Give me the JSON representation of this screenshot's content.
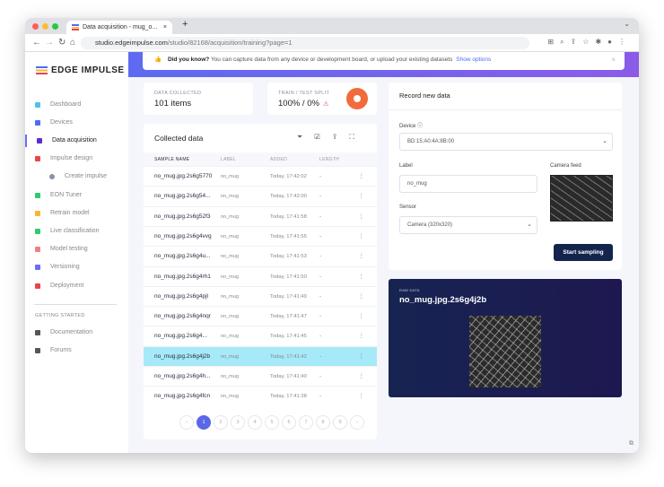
{
  "browser": {
    "tab_title": "Data acquisition - mug_o...",
    "url": "studio.edgeimpulse.com/studio/82168/acquisition/training?page=1",
    "url_host": "studio.edgeimpulse.com",
    "url_path": "/studio/82168/acquisition/training?page=1"
  },
  "logo": "EDGE IMPULSE",
  "sidebar": {
    "items": [
      {
        "label": "Dashboard",
        "color": "#4cc3e0"
      },
      {
        "label": "Devices",
        "color": "#4a6cf7"
      },
      {
        "label": "Data acquisition",
        "color": "#5b2bd1"
      },
      {
        "label": "Impulse design",
        "color": "#e84545"
      },
      {
        "label": "Create impulse",
        "color": "#8892a8"
      },
      {
        "label": "EON Tuner",
        "color": "#2ecc71"
      },
      {
        "label": "Retrain model",
        "color": "#f7b731"
      },
      {
        "label": "Live classification",
        "color": "#2ecc71"
      },
      {
        "label": "Model testing",
        "color": "#f08080"
      },
      {
        "label": "Versioning",
        "color": "#6b6ef8"
      },
      {
        "label": "Deployment",
        "color": "#e84545"
      }
    ],
    "section": "GETTING STARTED",
    "extra": [
      {
        "label": "Documentation"
      },
      {
        "label": "Forums"
      }
    ]
  },
  "banner": {
    "bold": "Did you know?",
    "text": "You can capture data from any device or development board, or upload your existing datasets",
    "link": "Show options"
  },
  "stats": {
    "collected_label": "DATA COLLECTED",
    "collected_value": "101 items",
    "split_label": "TRAIN / TEST SPLIT",
    "split_value": "100% / 0%"
  },
  "collected": {
    "title": "Collected data",
    "columns": [
      "SAMPLE NAME",
      "LABEL",
      "ADDED",
      "LENGTH"
    ],
    "rows": [
      {
        "name": "no_mug.jpg.2s6g5770",
        "label": "no_mug",
        "added": "Today, 17:42:02",
        "length": "-"
      },
      {
        "name": "no_mug.jpg.2s6g54...",
        "label": "no_mug",
        "added": "Today, 17:42:00",
        "length": "-"
      },
      {
        "name": "no_mug.jpg.2s6g52f3",
        "label": "no_mug",
        "added": "Today, 17:41:58",
        "length": "-"
      },
      {
        "name": "no_mug.jpg.2s6g4vvg",
        "label": "no_mug",
        "added": "Today, 17:41:55",
        "length": "-"
      },
      {
        "name": "no_mug.jpg.2s6g4u...",
        "label": "no_mug",
        "added": "Today, 17:41:53",
        "length": "-"
      },
      {
        "name": "no_mug.jpg.2s6g4rh1",
        "label": "no_mug",
        "added": "Today, 17:41:50",
        "length": "-"
      },
      {
        "name": "no_mug.jpg.2s6g4pjl",
        "label": "no_mug",
        "added": "Today, 17:41:49",
        "length": "-"
      },
      {
        "name": "no_mug.jpg.2s6g4nqr",
        "label": "no_mug",
        "added": "Today, 17:41:47",
        "length": "-"
      },
      {
        "name": "no_mug.jpg.2s6g4...",
        "label": "no_mug",
        "added": "Today, 17:41:45",
        "length": "-"
      },
      {
        "name": "no_mug.jpg.2s6g4j2b",
        "label": "no_mug",
        "added": "Today, 17:41:42",
        "length": "-",
        "selected": true
      },
      {
        "name": "no_mug.jpg.2s6g4h...",
        "label": "no_mug",
        "added": "Today, 17:41:40",
        "length": "-"
      },
      {
        "name": "no_mug.jpg.2s6g4fcn",
        "label": "no_mug",
        "added": "Today, 17:41:38",
        "length": "-"
      }
    ],
    "pages": [
      "‹",
      "1",
      "2",
      "3",
      "4",
      "5",
      "6",
      "7",
      "8",
      "9",
      "›"
    ],
    "current_page": "1"
  },
  "record": {
    "title": "Record new data",
    "device_label": "Device",
    "device_value": "BD:15:A0:4A:8B:00",
    "label_label": "Label",
    "label_value": "no_mug",
    "camera_label": "Camera feed",
    "sensor_label": "Sensor",
    "sensor_value": "Camera (320x320)",
    "start": "Start sampling"
  },
  "raw": {
    "kicker": "Raw data",
    "name": "no_mug.jpg.2s6g4j2b"
  }
}
